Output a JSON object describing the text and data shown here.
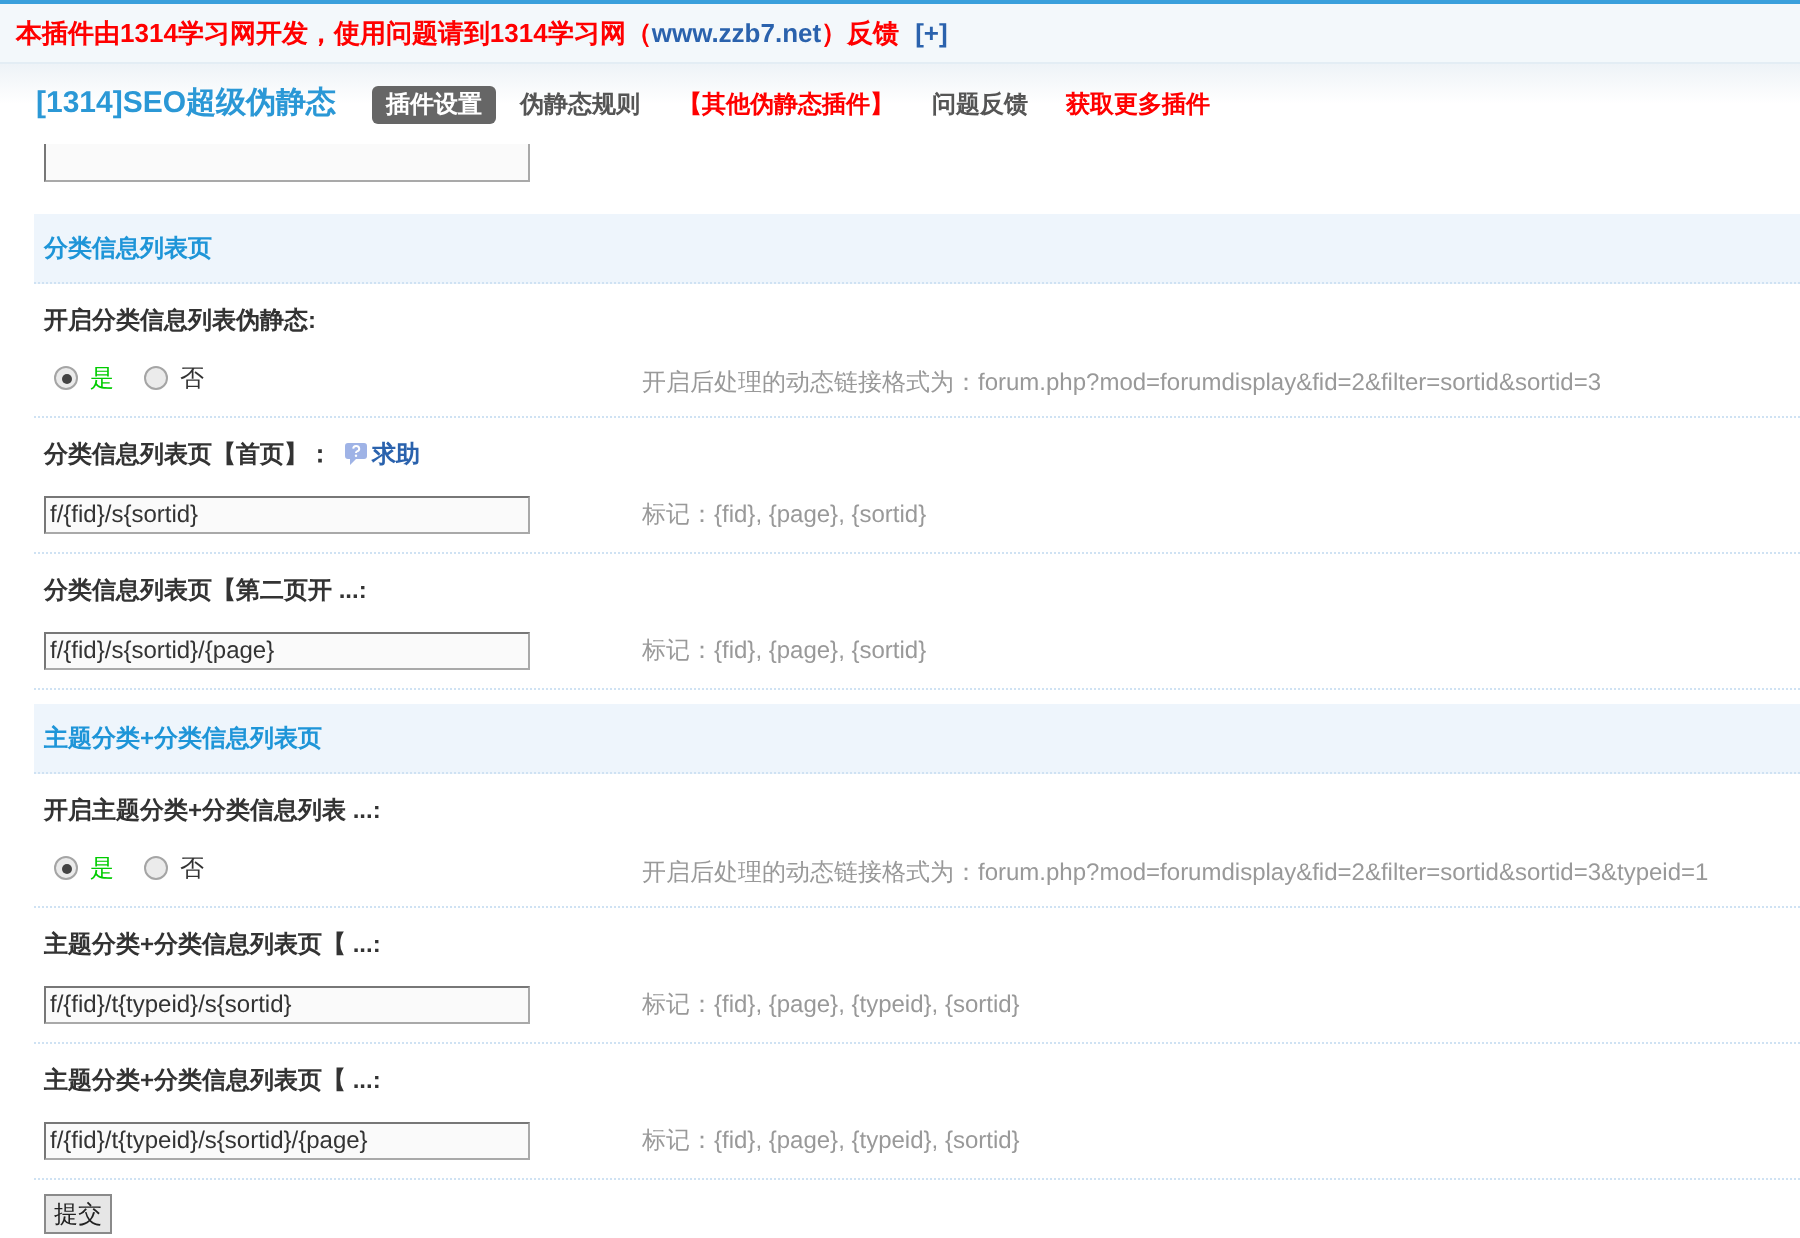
{
  "notice": {
    "text": "本插件由1314学习网开发，使用问题请到1314学习网（",
    "link": "www.zzb7.net",
    "text_end": "）反馈",
    "expand": "[+]"
  },
  "header": {
    "title": "[1314]SEO超级伪静态",
    "tabs": [
      {
        "label": "插件设置",
        "selected": true
      },
      {
        "label": "伪静态规则",
        "selected": false,
        "color": "#555555"
      },
      {
        "label": "【其他伪静态插件】",
        "selected": false,
        "color": "#ff0000"
      },
      {
        "label": "问题反馈",
        "selected": false,
        "color": "#555555"
      },
      {
        "label": "获取更多插件",
        "selected": false,
        "color": "#ff0000"
      }
    ]
  },
  "sections": [
    {
      "heading": "分类信息列表页",
      "rows": [
        {
          "kind": "radio",
          "label": "开启分类信息列表伪静态:",
          "options": [
            {
              "label": "是",
              "selected": true,
              "color": "#00cc00"
            },
            {
              "label": "否",
              "selected": false,
              "color": "#333333"
            }
          ],
          "hint": "开启后处理的动态链接格式为：forum.php?mod=forumdisplay&fid=2&filter=sortid&sortid=3"
        },
        {
          "kind": "text",
          "label": "分类信息列表页【首页】：",
          "help": "求助",
          "value": "f/{fid}/s{sortid}",
          "hint": "标记：{fid}, {page}, {sortid}"
        },
        {
          "kind": "text",
          "label": "分类信息列表页【第二页开 ...:",
          "value": "f/{fid}/s{sortid}/{page}",
          "hint": "标记：{fid}, {page}, {sortid}"
        }
      ]
    },
    {
      "heading": "主题分类+分类信息列表页",
      "rows": [
        {
          "kind": "radio",
          "label": "开启主题分类+分类信息列表 ...:",
          "options": [
            {
              "label": "是",
              "selected": true,
              "color": "#00cc00"
            },
            {
              "label": "否",
              "selected": false,
              "color": "#333333"
            }
          ],
          "hint": "开启后处理的动态链接格式为：forum.php?mod=forumdisplay&fid=2&filter=sortid&sortid=3&typeid=1"
        },
        {
          "kind": "text",
          "label": "主题分类+分类信息列表页【 ...:",
          "value": "f/{fid}/t{typeid}/s{sortid}",
          "hint": "标记：{fid}, {page}, {typeid}, {sortid}"
        },
        {
          "kind": "text",
          "label": "主题分类+分类信息列表页【 ...:",
          "value": "f/{fid}/t{typeid}/s{sortid}/{page}",
          "hint": "标记：{fid}, {page}, {typeid}, {sortid}"
        }
      ]
    }
  ],
  "submit": "提交"
}
